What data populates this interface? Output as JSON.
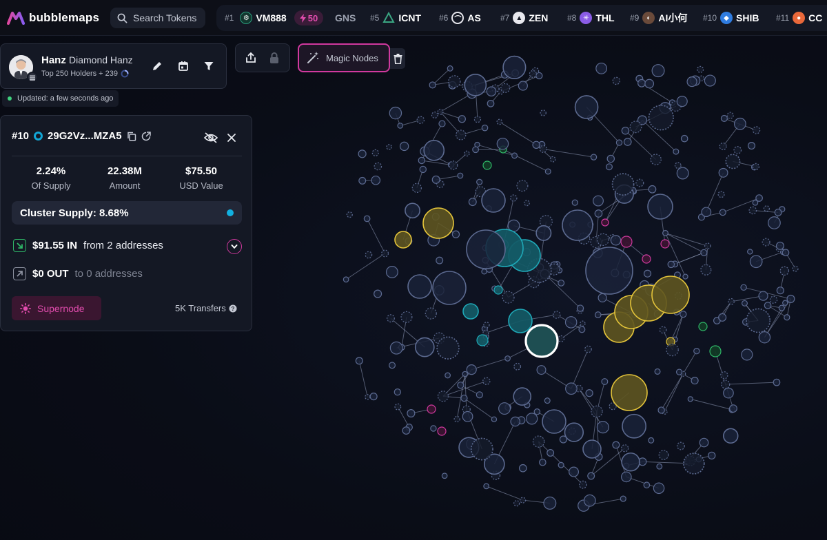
{
  "app": {
    "name": "bubblemaps"
  },
  "search": {
    "placeholder": "Search Tokens"
  },
  "ticker": [
    {
      "rank": "#1",
      "name": "VM888",
      "boost": "50",
      "color": "#2a9d7d"
    },
    {
      "rank": "",
      "name": "GNS",
      "color": ""
    },
    {
      "rank": "#5",
      "name": "ICNT",
      "color": "#3aa582"
    },
    {
      "rank": "#6",
      "name": "AS",
      "color": "#e8e8ee"
    },
    {
      "rank": "#7",
      "name": "ZEN",
      "color": "#e8e8ee"
    },
    {
      "rank": "#8",
      "name": "THL",
      "color": "#8a5ce6"
    },
    {
      "rank": "#9",
      "name": "AI小何",
      "color": "#6a4a3a"
    },
    {
      "rank": "#10",
      "name": "SHIB",
      "color": "#2f7ce0"
    },
    {
      "rank": "#11",
      "name": "CC",
      "color": "#e9683a"
    }
  ],
  "map": {
    "owner": "Hanz",
    "name": "Diamond Hanz",
    "subtitle": "Top 250 Holders + 239",
    "updated": "Updated: a few seconds ago"
  },
  "toolbar": {
    "magic_nodes": "Magic Nodes"
  },
  "detail": {
    "rank": "#10",
    "address": "29G2Vz...MZA5",
    "stats": [
      {
        "value": "2.24%",
        "label": "Of Supply"
      },
      {
        "value": "22.38M",
        "label": "Amount"
      },
      {
        "value": "$75.50",
        "label": "USD Value"
      }
    ],
    "cluster_supply": "Cluster Supply: 8.68%",
    "in_amount": "$91.55 IN",
    "in_from": "from 2 addresses",
    "out_amount": "$0 OUT",
    "out_to": "to 0 addresses",
    "supernode": "Supernode",
    "transfers": "5K Transfers"
  },
  "colors": {
    "accent_pink": "#d1399f",
    "node_default": "#1a2238",
    "node_cyan": "#1fa9b8",
    "node_yellow": "#e4c43a",
    "node_green": "#2fb868"
  },
  "graph_groups": [
    "default",
    "cyan",
    "yellow",
    "pink",
    "green",
    "selected"
  ]
}
